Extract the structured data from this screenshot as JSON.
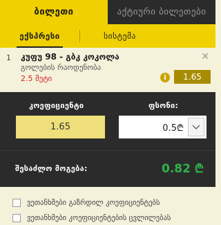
{
  "tabs": [
    {
      "label": "ბილეთი",
      "active": true
    },
    {
      "label": "აქტიური ბილეთები",
      "active": false
    }
  ],
  "subtabs": [
    {
      "label": "ექსპრესი",
      "active": true
    },
    {
      "label": "სისტემა",
      "active": false
    }
  ],
  "bet": {
    "number": "1",
    "match": "კუფუ 98 - გბკ კოკოლა",
    "market": "გოლების რაოდენობა",
    "selection": "2.5 მეტი",
    "odd": "1.65",
    "close_icon": "close-icon",
    "info_icon": "info-icon"
  },
  "stake": {
    "coefficient_label": "კოეფიციენტი",
    "coefficient_value": "1.65",
    "amount_label": "ფსონი:",
    "amount_value": "0.5₾"
  },
  "win": {
    "label": "შესაძლო მოგება:",
    "value": "0.82 ₾"
  },
  "options": [
    {
      "label": "ვეთანხმები გაზრდილ კოეფიციენტებს",
      "checked": false
    },
    {
      "label": "ვეთანხმები კოეფიციენტების ცვლილებას",
      "checked": false
    }
  ],
  "colors": {
    "accent": "#f0d000",
    "dark": "#2b2b2b",
    "win": "#2fb34a",
    "selection": "#d32323"
  }
}
